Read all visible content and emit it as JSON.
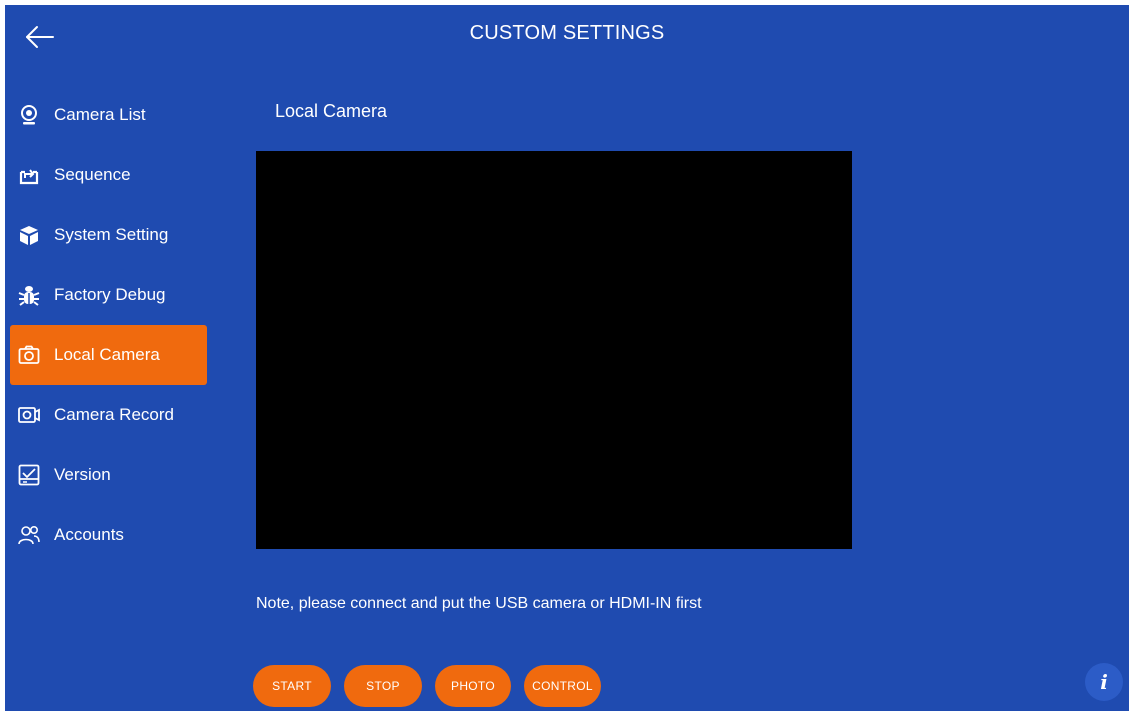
{
  "header": {
    "title": "CUSTOM SETTINGS",
    "back_icon": "arrow-left-icon"
  },
  "sidebar": {
    "items": [
      {
        "label": "Camera List",
        "icon": "webcam-icon",
        "active": false
      },
      {
        "label": "Sequence",
        "icon": "sequence-icon",
        "active": false
      },
      {
        "label": "System Setting",
        "icon": "cube-icon",
        "active": false
      },
      {
        "label": "Factory Debug",
        "icon": "bug-icon",
        "active": false
      },
      {
        "label": "Local Camera",
        "icon": "camera-icon",
        "active": true
      },
      {
        "label": "Camera Record",
        "icon": "video-camera-icon",
        "active": false
      },
      {
        "label": "Version",
        "icon": "version-icon",
        "active": false
      },
      {
        "label": "Accounts",
        "icon": "users-icon",
        "active": false
      }
    ]
  },
  "main": {
    "section_title": "Local Camera",
    "note": "Note, please connect and put the USB camera or HDMI-IN first",
    "buttons": {
      "start": "START",
      "stop": "STOP",
      "photo": "PHOTO",
      "control": "CONTROL"
    },
    "info_label": "i"
  },
  "colors": {
    "background": "#1f4bb0",
    "accent": "#f06a0e",
    "video_bg": "#000000",
    "text": "#ffffff"
  }
}
